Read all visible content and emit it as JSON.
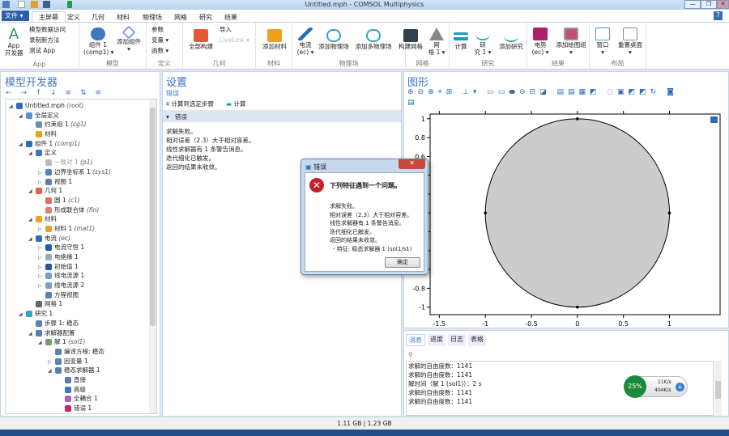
{
  "window": {
    "title": "Untitled.mph - COMSOL Multiphysics",
    "minimize": "—",
    "maximize": "❐",
    "close": "✕",
    "help": "?"
  },
  "ribbon_tabs": {
    "file": "文件 ▾",
    "tabs": [
      "主屏幕",
      "定义",
      "几何",
      "材料",
      "物理场",
      "网格",
      "研究",
      "结果"
    ]
  },
  "ribbon": {
    "app": {
      "label": "App",
      "dev": "App\n开发器",
      "items": [
        "模型数据访问",
        "录制新方法",
        "测试 App"
      ]
    },
    "model": {
      "label": "模型",
      "comp": "组件 1\n(comp1) ▾",
      "add_comp": "添加组件\n▾"
    },
    "defs": {
      "label": "定义",
      "items": [
        "参数",
        "变量 ▾",
        "函数 ▾"
      ]
    },
    "geom": {
      "label": "几何",
      "build": "全部构建",
      "import": "导入",
      "livelink": "LiveLink ▾"
    },
    "mat": {
      "label": "材料",
      "add": "添加材料"
    },
    "phys": {
      "label": "物理场",
      "ec": "电流\n(ec) ▾",
      "add_phys": "添加物理场",
      "add_multi": "添加多物理场"
    },
    "mesh": {
      "label": "网格",
      "build": "构建网格",
      "mesh1": "网\n格 1 ▾"
    },
    "study": {
      "label": "研究",
      "compute": "计算",
      "study1": "研\n究 1 ▾",
      "add": "添加研究"
    },
    "results": {
      "label": "结果",
      "potential": "电势\n(ec) ▾",
      "add_group": "添加绘图组\n▾"
    },
    "layout": {
      "label": "布局",
      "window": "窗口\n▾",
      "reset": "重置桌面\n▾"
    }
  },
  "model_builder": {
    "title": "模型开发器",
    "tree": [
      {
        "l": 0,
        "exp": "◢",
        "icon": "#2e6db5",
        "t": "Untitled.mph",
        "i": "(root)"
      },
      {
        "l": 1,
        "exp": "◢",
        "icon": "#5a8fd0",
        "t": "全局定义",
        "i": ""
      },
      {
        "l": 2,
        "exp": "",
        "icon": "#6a8fb5",
        "t": "约束组 1",
        "i": "(cg1)"
      },
      {
        "l": 2,
        "exp": "",
        "icon": "#f0a020",
        "t": "材料",
        "i": ""
      },
      {
        "l": 1,
        "exp": "◢",
        "icon": "#2e6db5",
        "t": "组件 1",
        "i": "(comp1)"
      },
      {
        "l": 2,
        "exp": "◢",
        "icon": "#3b79c4",
        "t": "定义",
        "i": ""
      },
      {
        "l": 3,
        "exp": "",
        "icon": "#bbb",
        "t": "一致对 1",
        "i": "(p1)",
        "gray": true
      },
      {
        "l": 3,
        "exp": "▷",
        "icon": "#5a7fb0",
        "t": "边界坐标系 1",
        "i": "(sys1)"
      },
      {
        "l": 3,
        "exp": "▷",
        "icon": "#5a7fb0",
        "t": "视图 1",
        "i": ""
      },
      {
        "l": 2,
        "exp": "◢",
        "icon": "#e06040",
        "t": "几何 1",
        "i": ""
      },
      {
        "l": 3,
        "exp": "",
        "icon": "#e07060",
        "t": "圆 1",
        "i": "(c1)"
      },
      {
        "l": 3,
        "exp": "",
        "icon": "#e08070",
        "t": "形成联合体",
        "i": "(fin)"
      },
      {
        "l": 2,
        "exp": "◢",
        "icon": "#f0a020",
        "t": "材料",
        "i": ""
      },
      {
        "l": 3,
        "exp": "▷",
        "icon": "#f0a020",
        "t": "材料 1",
        "i": "(mat1)"
      },
      {
        "l": 2,
        "exp": "◢",
        "icon": "#2e6db5",
        "t": "电流",
        "i": "(ec)"
      },
      {
        "l": 3,
        "exp": "▷",
        "icon": "#1d5a9e",
        "t": "电流守恒 1",
        "i": ""
      },
      {
        "l": 3,
        "exp": "▷",
        "icon": "#9ab",
        "t": "电绝缘 1",
        "i": ""
      },
      {
        "l": 3,
        "exp": "▷",
        "icon": "#1d5a9e",
        "t": "初始值 1",
        "i": ""
      },
      {
        "l": 3,
        "exp": "▷",
        "icon": "#7a9cc8",
        "t": "线电流源 1",
        "i": ""
      },
      {
        "l": 3,
        "exp": "▷",
        "icon": "#7a9cc8",
        "t": "线电流源 2",
        "i": ""
      },
      {
        "l": 3,
        "exp": "",
        "icon": "#5a7fb0",
        "t": "方程视图",
        "i": ""
      },
      {
        "l": 2,
        "exp": "",
        "icon": "#666",
        "t": "网格 1",
        "i": ""
      },
      {
        "l": 1,
        "exp": "◢",
        "icon": "#3aa0c0",
        "t": "研究 1",
        "i": ""
      },
      {
        "l": 2,
        "exp": "",
        "icon": "#5a7fb0",
        "t": "步骤 1: 稳态",
        "i": ""
      },
      {
        "l": 2,
        "exp": "◢",
        "icon": "#5a7fb0",
        "t": "求解器配置",
        "i": ""
      },
      {
        "l": 3,
        "exp": "◢",
        "icon": "#6a9f6a",
        "t": "解 1",
        "i": "(sol1)"
      },
      {
        "l": 4,
        "exp": "",
        "icon": "#5a7fb0",
        "t": "编译方程: 稳态",
        "i": ""
      },
      {
        "l": 4,
        "exp": "▷",
        "icon": "#5a7fb0",
        "t": "因变量 1",
        "i": ""
      },
      {
        "l": 4,
        "exp": "◢",
        "icon": "#5a7fb0",
        "t": "稳态求解器 1",
        "i": ""
      },
      {
        "l": 5,
        "exp": "",
        "icon": "#5a7fb0",
        "t": "直接",
        "i": ""
      },
      {
        "l": 5,
        "exp": "",
        "icon": "#3b79c4",
        "t": "高级",
        "i": ""
      },
      {
        "l": 5,
        "exp": "",
        "icon": "#b060c0",
        "t": "全耦合 1",
        "i": ""
      },
      {
        "l": 5,
        "exp": "",
        "icon": "#d02060",
        "t": "错误 1",
        "i": ""
      }
    ]
  },
  "settings": {
    "title": "设置",
    "subtitle": "错误",
    "compute_to": "计算到选定步骤",
    "compute": "计算",
    "section": "错误",
    "lines": [
      "求解失败。",
      "相对误差（2.3）大于相对容差。",
      "线性求解器有 1 条警告消息。",
      "迭代细化已触发。",
      "返回的结果未收敛。"
    ]
  },
  "graphics": {
    "title": "图形"
  },
  "chart_data": {
    "type": "scatter",
    "title": "",
    "xlabel": "",
    "ylabel": "",
    "xlim": [
      -1.6,
      1.55
    ],
    "ylim": [
      -1.08,
      1.05
    ],
    "x_ticks": [
      "-1.5",
      "-1",
      "-0.5",
      "0",
      "0.5",
      "1"
    ],
    "x_tick_values": [
      -1.5,
      -1,
      -0.5,
      0,
      0.5,
      1
    ],
    "y_ticks": [
      "1",
      "0.8",
      "0.6",
      "0.4",
      "0.2",
      "0",
      "-0.2",
      "-0.4",
      "-0.6",
      "-0.8",
      "-1"
    ],
    "y_tick_values": [
      1,
      0.8,
      0.6,
      0.4,
      0.2,
      0,
      -0.2,
      -0.4,
      -0.6,
      -0.8,
      -1
    ],
    "circle": {
      "center": [
        0,
        0
      ],
      "radius": 1,
      "fill": "#cccccc"
    },
    "points": [
      [
        0,
        1
      ],
      [
        1,
        0
      ],
      [
        0,
        -1
      ],
      [
        -1,
        0
      ]
    ]
  },
  "dialog": {
    "title": "错误",
    "heading": "下列特征遇到一个问题。",
    "lines": [
      "求解失败。",
      "相对误差（2.3）大于相对容差。",
      "线性求解器有 1 条警告消息。",
      "迭代细化已触发。",
      "返回的结果未收敛。",
      "- 特征: 稳态求解器 1 (sol1/s1)"
    ],
    "ok": "确定"
  },
  "messages": {
    "tabs": [
      "消息",
      "进度",
      "日志",
      "表格"
    ],
    "lines": [
      "求解的自由度数：1141",
      "求解的自由度数：1141",
      "解时间（解 1 (sol1)）：2 s",
      "求解的自由度数：1141",
      "求解的自由度数：1141"
    ]
  },
  "net_widget": {
    "percent": "25%",
    "up": "11K/s",
    "down": "404K/s"
  },
  "status": {
    "memory": "1.11 GB | 1.23 GB"
  }
}
